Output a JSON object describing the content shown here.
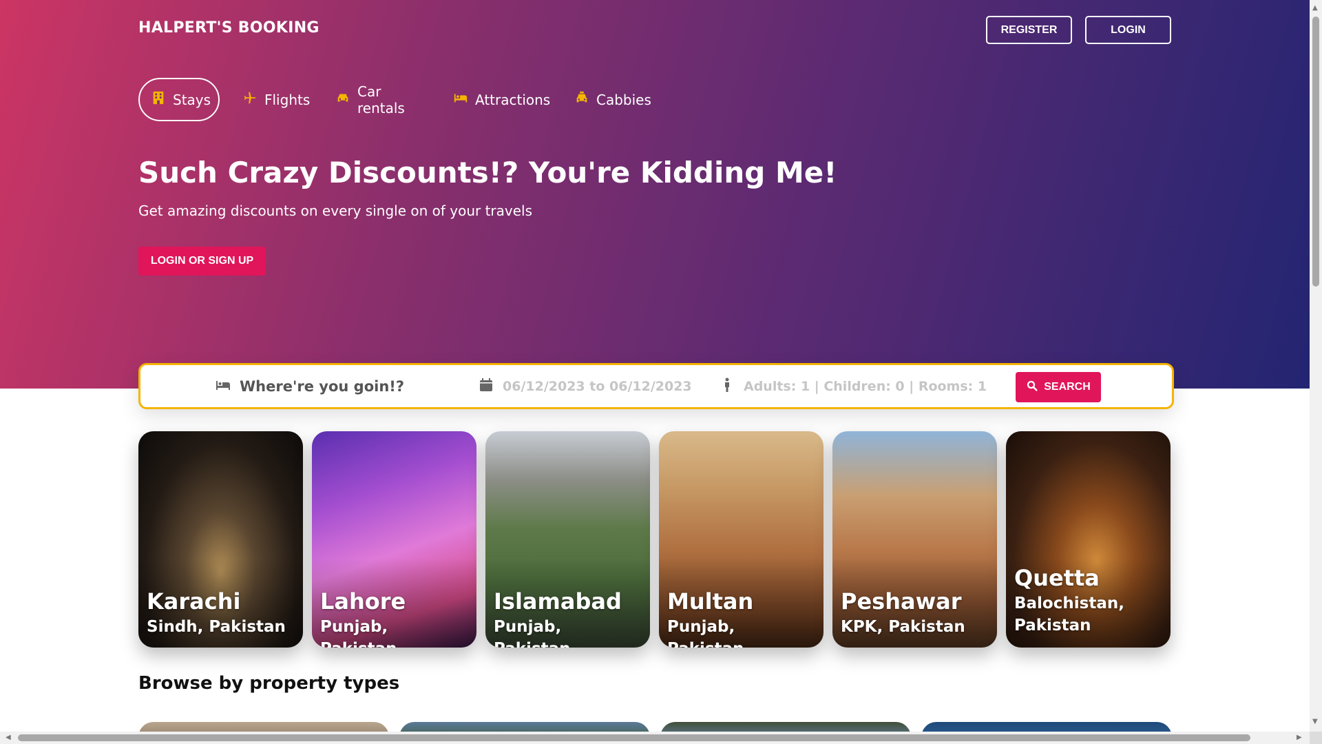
{
  "header": {
    "brand": "HALPERT'S BOOKING",
    "register_label": "REGISTER",
    "login_label": "LOGIN"
  },
  "nav": {
    "items": [
      {
        "label": "Stays",
        "icon": "hotel-icon",
        "active": true
      },
      {
        "label": "Flights",
        "icon": "plane-icon"
      },
      {
        "label": "Car rentals",
        "icon": "car-icon"
      },
      {
        "label": "Attractions",
        "icon": "bed-icon"
      },
      {
        "label": "Cabbies",
        "icon": "taxi-icon"
      }
    ]
  },
  "hero": {
    "headline": "Such Crazy Discounts!? You're Kidding Me!",
    "subheadline": "Get amazing discounts on every single on of your travels",
    "cta_label": "LOGIN OR SIGN UP"
  },
  "search": {
    "destination_placeholder": "Where're you goin!?",
    "dates": "06/12/2023 to 06/12/2023",
    "occupancy": "Adults: 1 | Children: 0 | Rooms: 1",
    "button_label": "SEARCH"
  },
  "cities": [
    {
      "name": "Karachi",
      "region": "Sindh, Pakistan"
    },
    {
      "name": "Lahore",
      "region": "Punjab, Pakistan"
    },
    {
      "name": "Islamabad",
      "region": "Punjab, Pakistan"
    },
    {
      "name": "Multan",
      "region": "Punjab, Pakistan"
    },
    {
      "name": "Peshawar",
      "region": "KPK, Pakistan"
    },
    {
      "name": "Quetta",
      "region": "Balochistan, Pakistan"
    }
  ],
  "property_section": {
    "title": "Browse by property types"
  },
  "colors": {
    "accent": "#e0155a",
    "icon_yellow": "#f5b400",
    "search_border": "#f4b400",
    "hero_start": "#cc3564",
    "hero_end": "#232572"
  }
}
